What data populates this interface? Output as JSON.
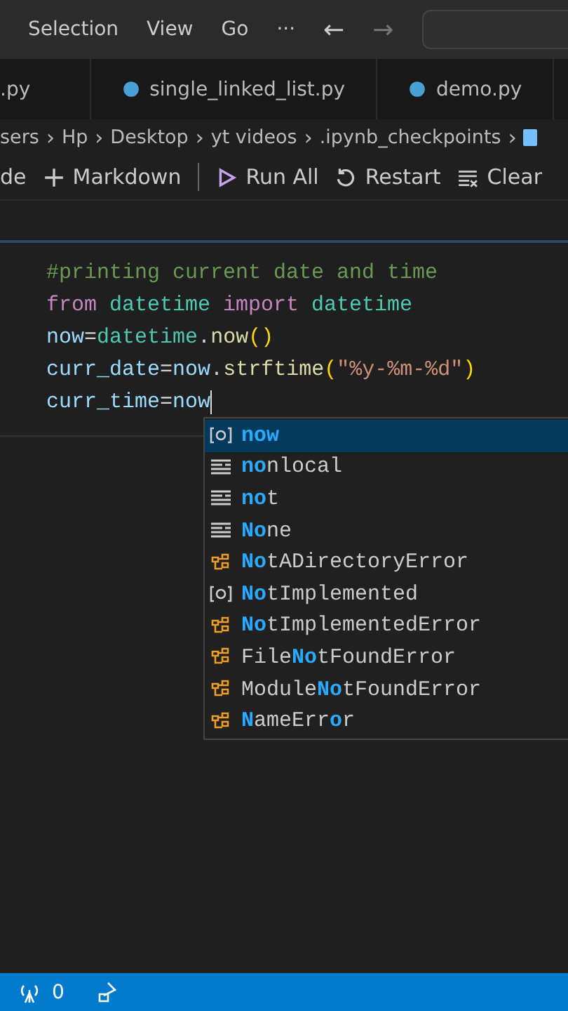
{
  "menu": [
    "Selection",
    "View",
    "Go",
    "···"
  ],
  "nav": {
    "back": "←",
    "forward": "→"
  },
  "tabs": [
    {
      "label": ".py",
      "icon": false,
      "selected": false
    },
    {
      "label": "single_linked_list.py",
      "icon": true,
      "selected": false
    },
    {
      "label": "demo.py",
      "icon": true,
      "selected": false
    }
  ],
  "breadcrumbs": [
    {
      "label": "sers",
      "separator": "›"
    },
    {
      "label": "Hp",
      "separator": "›"
    },
    {
      "label": "Desktop",
      "separator": "›"
    },
    {
      "label": "yt videos",
      "separator": "›"
    },
    {
      "label": ".ipynb_checkpoints",
      "separator": "›"
    }
  ],
  "toolbar": [
    {
      "kind": "text",
      "label": "de"
    },
    {
      "kind": "plus",
      "label": "Markdown"
    },
    {
      "kind": "run",
      "label": "Run All"
    },
    {
      "kind": "restart",
      "label": "Restart"
    },
    {
      "kind": "clear",
      "label": "Clear"
    }
  ],
  "code": [
    [
      {
        "kind": "comment",
        "text": "#printing current date and time"
      }
    ],
    [
      {
        "kind": "keyword",
        "text": "from "
      },
      {
        "kind": "module",
        "text": "datetime "
      },
      {
        "kind": "keyword",
        "text": "import "
      },
      {
        "kind": "module",
        "text": "datetime"
      }
    ],
    [
      {
        "kind": "var",
        "text": "now"
      },
      {
        "kind": "plain",
        "text": "="
      },
      {
        "kind": "module",
        "text": "datetime"
      },
      {
        "kind": "plain",
        "text": "."
      },
      {
        "kind": "func",
        "text": "now"
      },
      {
        "kind": "paren",
        "text": "()"
      }
    ],
    [
      {
        "kind": "var",
        "text": "curr_date"
      },
      {
        "kind": "plain",
        "text": "="
      },
      {
        "kind": "var",
        "text": "now"
      },
      {
        "kind": "plain",
        "text": "."
      },
      {
        "kind": "func",
        "text": "strftime"
      },
      {
        "kind": "paren",
        "text": "("
      },
      {
        "kind": "string",
        "text": "\"%y-%m-%d\""
      },
      {
        "kind": "paren",
        "text": ")"
      }
    ],
    [
      {
        "kind": "var",
        "text": "curr_time"
      },
      {
        "kind": "plain",
        "text": "="
      },
      {
        "kind": "var",
        "text": "now"
      }
    ]
  ],
  "suggestions": [
    {
      "kind": "variable",
      "selected": true,
      "parts": [
        {
          "text": "now",
          "match": true
        }
      ]
    },
    {
      "kind": "keyword",
      "selected": false,
      "parts": [
        {
          "text": "no",
          "match": true
        },
        {
          "text": "nlocal",
          "match": false
        }
      ]
    },
    {
      "kind": "keyword",
      "selected": false,
      "parts": [
        {
          "text": "no",
          "match": true
        },
        {
          "text": "t",
          "match": false
        }
      ]
    },
    {
      "kind": "keyword",
      "selected": false,
      "parts": [
        {
          "text": "No",
          "match": true
        },
        {
          "text": "ne",
          "match": false
        }
      ]
    },
    {
      "kind": "class",
      "selected": false,
      "parts": [
        {
          "text": "No",
          "match": true
        },
        {
          "text": "tADirectoryError",
          "match": false
        }
      ]
    },
    {
      "kind": "variable",
      "selected": false,
      "parts": [
        {
          "text": "No",
          "match": true
        },
        {
          "text": "tImplemented",
          "match": false
        }
      ]
    },
    {
      "kind": "class",
      "selected": false,
      "parts": [
        {
          "text": "No",
          "match": true
        },
        {
          "text": "tImplementedError",
          "match": false
        }
      ]
    },
    {
      "kind": "class",
      "selected": false,
      "parts": [
        {
          "text": "File",
          "match": false
        },
        {
          "text": "No",
          "match": true
        },
        {
          "text": "tFoundError",
          "match": false
        }
      ]
    },
    {
      "kind": "class",
      "selected": false,
      "parts": [
        {
          "text": "Module",
          "match": false
        },
        {
          "text": "No",
          "match": true
        },
        {
          "text": "tFoundError",
          "match": false
        }
      ]
    },
    {
      "kind": "class",
      "selected": false,
      "parts": [
        {
          "text": "N",
          "match": true
        },
        {
          "text": "ameErr",
          "match": false
        },
        {
          "text": "o",
          "match": true
        },
        {
          "text": "r",
          "match": false
        }
      ]
    }
  ],
  "status_bar": {
    "ports": "0"
  }
}
